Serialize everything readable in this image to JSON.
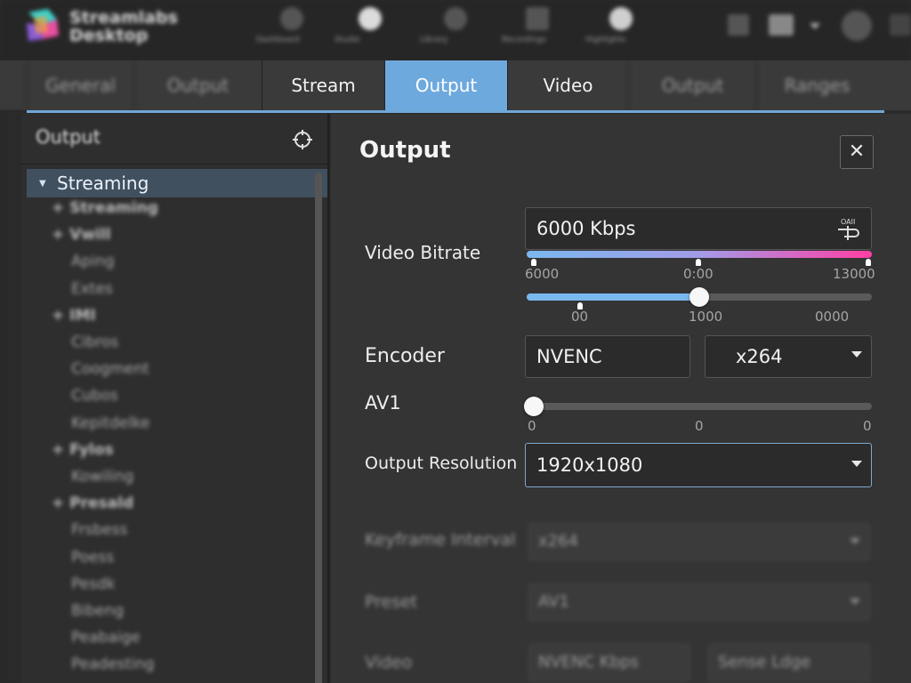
{
  "app": {
    "title_line1": "Streamlabs",
    "title_line2": "Desktop",
    "nav": [
      {
        "label": "Dashboard",
        "icon": "cloud-icon"
      },
      {
        "label": "Studio",
        "icon": "circle-icon"
      },
      {
        "label": "Library",
        "icon": "gear-icon"
      },
      {
        "label": "Recordings",
        "icon": "grid-icon"
      },
      {
        "label": "Highlights",
        "icon": "record-icon"
      }
    ]
  },
  "tabs": [
    {
      "label": "General",
      "state": "faded"
    },
    {
      "label": "Output",
      "state": "faded"
    },
    {
      "label": "Stream",
      "state": "normal"
    },
    {
      "label": "Output",
      "state": "active"
    },
    {
      "label": "Video",
      "state": "normal"
    },
    {
      "label": "Output",
      "state": "faded"
    },
    {
      "label": "Ranges",
      "state": "faded"
    }
  ],
  "sidebar": {
    "title": "Output",
    "selected": "Streaming",
    "items": [
      {
        "label": "Streaming",
        "bold": true,
        "expander": "+"
      },
      {
        "label": "Vwill",
        "bold": true,
        "expander": "+"
      },
      {
        "label": "Aping",
        "bold": false,
        "expander": ""
      },
      {
        "label": "Extes",
        "bold": false,
        "expander": ""
      },
      {
        "label": "IMI",
        "bold": true,
        "expander": "+"
      },
      {
        "label": "Cibros",
        "bold": false,
        "expander": ""
      },
      {
        "label": "Coogment",
        "bold": false,
        "expander": ""
      },
      {
        "label": "Cubos",
        "bold": false,
        "expander": ""
      },
      {
        "label": "Kepitdelke",
        "bold": false,
        "expander": ""
      },
      {
        "label": "Fylos",
        "bold": true,
        "expander": "+"
      },
      {
        "label": "Kowiling",
        "bold": false,
        "expander": ""
      },
      {
        "label": "Presald",
        "bold": true,
        "expander": "+"
      },
      {
        "label": "Frsbess",
        "bold": false,
        "expander": ""
      },
      {
        "label": "Poess",
        "bold": false,
        "expander": ""
      },
      {
        "label": "Pesdk",
        "bold": false,
        "expander": ""
      },
      {
        "label": "Bibeng",
        "bold": false,
        "expander": ""
      },
      {
        "label": "Peabaige",
        "bold": false,
        "expander": ""
      },
      {
        "label": "Peadesting",
        "bold": false,
        "expander": ""
      }
    ]
  },
  "main": {
    "title": "Output",
    "close_label": "✕",
    "video_bitrate": {
      "label": "Video Bitrate",
      "value": "6000 Kbps",
      "slider1": {
        "min_label": "6000",
        "mid_label": "0:00",
        "max_label": "13000"
      },
      "slider2": {
        "min_label": "00",
        "mid_label": "1000",
        "max_label": "0000",
        "value_fraction": 0.5
      }
    },
    "encoder": {
      "label": "Encoder",
      "value": "NVENC",
      "select": "x264"
    },
    "av1": {
      "label": "AV1",
      "min_label": "0",
      "mid_label": "0",
      "max_label": "0",
      "value_fraction": 0.0
    },
    "output_resolution": {
      "label": "Output Resolution",
      "value": "1920x1080"
    },
    "keyframe": {
      "label": "Keyframe Interval",
      "value": "x264"
    },
    "preset": {
      "label": "Preset",
      "value": "AV1"
    },
    "video": {
      "label": "Video",
      "value": "NVENC Kbps",
      "value2": "Sense Ldge"
    }
  },
  "colors": {
    "accent": "#6ea9de",
    "bitrate_gradient_start": "#7ab8f0",
    "bitrate_gradient_end": "#ff3fa4"
  }
}
